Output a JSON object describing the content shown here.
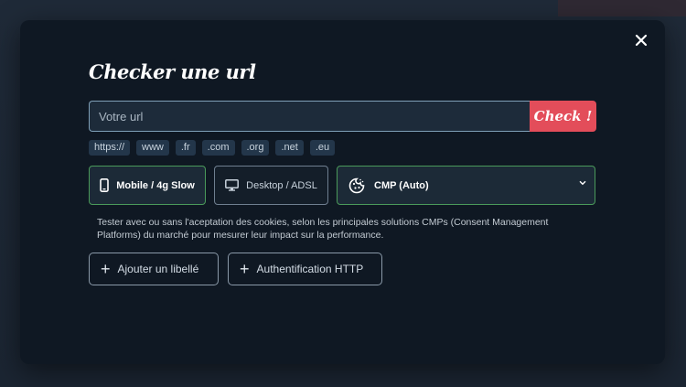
{
  "modal": {
    "title": "Checker une url",
    "close_icon": "close-icon"
  },
  "url": {
    "placeholder": "Votre url",
    "value": "",
    "check_label": "Check !"
  },
  "chips": [
    "https://",
    "www",
    ".fr",
    ".com",
    ".org",
    ".net",
    ".eu"
  ],
  "options": {
    "mobile_label": "Mobile / 4g Slow",
    "mobile_icon": "mobile-icon",
    "desktop_label": "Desktop / ADSL",
    "desktop_icon": "desktop-icon",
    "cmp_label": "CMP (Auto)",
    "cmp_icon": "cookie-icon"
  },
  "description": "Tester avec ou sans l'aceptation des cookies, selon les principales solutions CMPs (Consent Management Platforms) du marché pour mesurer leur impact sur la performance.",
  "actions": {
    "add_label": "Ajouter un libellé",
    "auth_label": "Authentification HTTP"
  },
  "colors": {
    "accent": "#e34d5a",
    "active_border": "#4a9a5a",
    "modal_bg": "#0f1823"
  }
}
